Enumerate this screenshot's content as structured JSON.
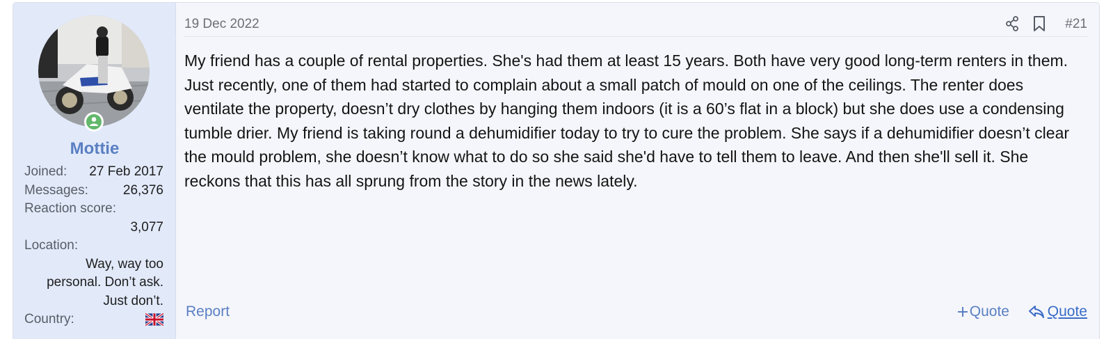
{
  "user": {
    "name": "Mottie",
    "stats": {
      "joined_label": "Joined:",
      "joined_value": "27 Feb 2017",
      "messages_label": "Messages:",
      "messages_value": "26,376",
      "reaction_label": "Reaction score:",
      "reaction_value": "3,077",
      "location_label": "Location:",
      "location_value": "Way, way too personal. Don’t ask. Just don’t.",
      "country_label": "Country:",
      "country_flag": "uk-flag-icon"
    }
  },
  "post": {
    "date": "19 Dec 2022",
    "number": "#21",
    "body": "My friend has a couple of rental properties. She's had them at least 15 years. Both have very good long-term renters in them. Just recently, one of them had started to complain about a small patch of mould on one of the ceilings. The renter does ventilate the property, doesn’t dry clothes by hanging them indoors (it is a 60’s flat in a block) but she does use a condensing tumble drier. My friend is taking round a dehumidifier today to try to cure the problem. She says if a dehumidifier doesn’t clear the mould problem, she doesn’t know what to do so she said she'd have to tell them to leave. And then she'll sell it. She reckons that this has all sprung from the story in the news lately."
  },
  "actions": {
    "report": "Report",
    "multi_quote": "Quote",
    "quote": "Quote"
  },
  "colors": {
    "link": "#5a7fc2",
    "user_bg": "#e2eafa",
    "post_bg": "#f5f6fb",
    "online": "#63b76b"
  }
}
